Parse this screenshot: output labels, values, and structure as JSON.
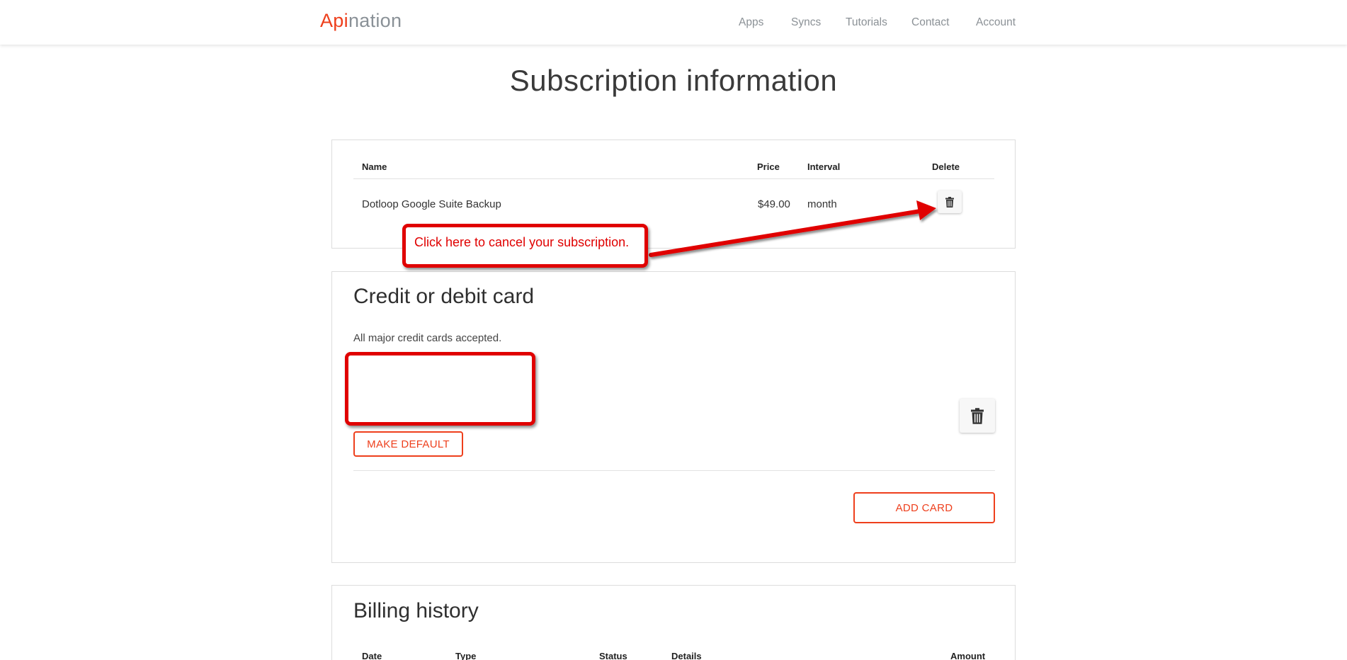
{
  "brand": {
    "logo_part1": "Api",
    "logo_part2": "nation",
    "accent_color": "#ee3f1c",
    "muted_color": "#8a9197"
  },
  "nav": {
    "items": [
      {
        "label": "Apps"
      },
      {
        "label": "Syncs"
      },
      {
        "label": "Tutorials"
      },
      {
        "label": "Contact"
      },
      {
        "label": "Account"
      }
    ]
  },
  "page": {
    "title": "Subscription information"
  },
  "subscriptions": {
    "headers": {
      "name": "Name",
      "price": "Price",
      "interval": "Interval",
      "delete": "Delete"
    },
    "rows": [
      {
        "name": "Dotloop Google Suite Backup",
        "price": "$49.00",
        "interval": "month",
        "delete_icon": "trash-icon"
      }
    ]
  },
  "payment": {
    "title": "Credit or debit card",
    "note": "All major credit cards accepted.",
    "make_default_label": "MAKE DEFAULT",
    "delete_icon": "trash-icon",
    "add_card_label": "ADD CARD"
  },
  "billing": {
    "title": "Billing history",
    "headers": {
      "date": "Date",
      "type": "Type",
      "status": "Status",
      "details": "Details",
      "amount": "Amount"
    }
  },
  "annotations": {
    "callout_text": "Click here to cancel your subscription.",
    "color": "#e00000"
  }
}
